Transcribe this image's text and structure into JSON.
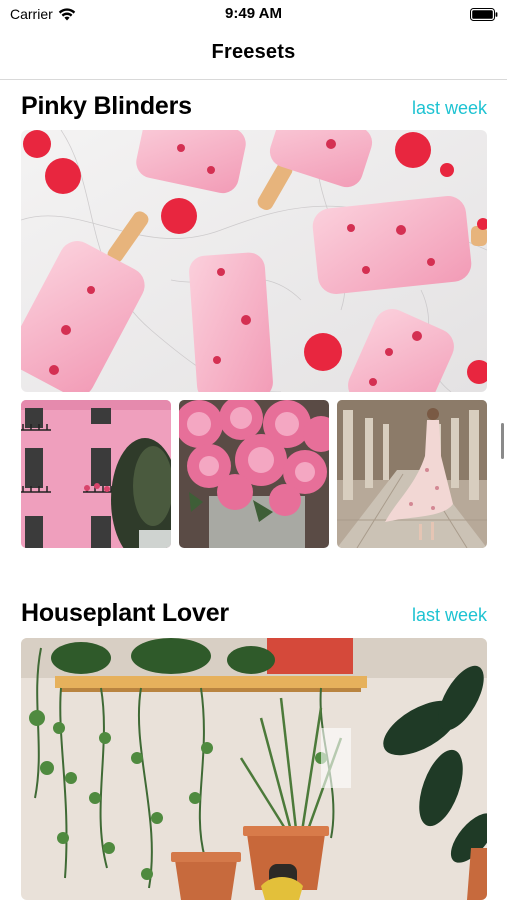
{
  "status_bar": {
    "carrier": "Carrier",
    "time": "9:49 AM",
    "wifi_icon": "wifi-icon",
    "battery_icon": "battery-icon"
  },
  "nav": {
    "title": "Freesets"
  },
  "sections": [
    {
      "title": "Pinky Blinders",
      "date": "last week",
      "hero_image": "pink-popsicles-on-marble",
      "thumbnails": [
        "pink-building-facade",
        "pink-peonies-bouquet",
        "woman-in-floral-dress-arcade"
      ]
    },
    {
      "title": "Houseplant Lover",
      "date": "last week",
      "hero_image": "houseplants-on-shelf"
    }
  ],
  "colors": {
    "accent": "#1ec3d2",
    "divider": "#d9d9d9"
  }
}
